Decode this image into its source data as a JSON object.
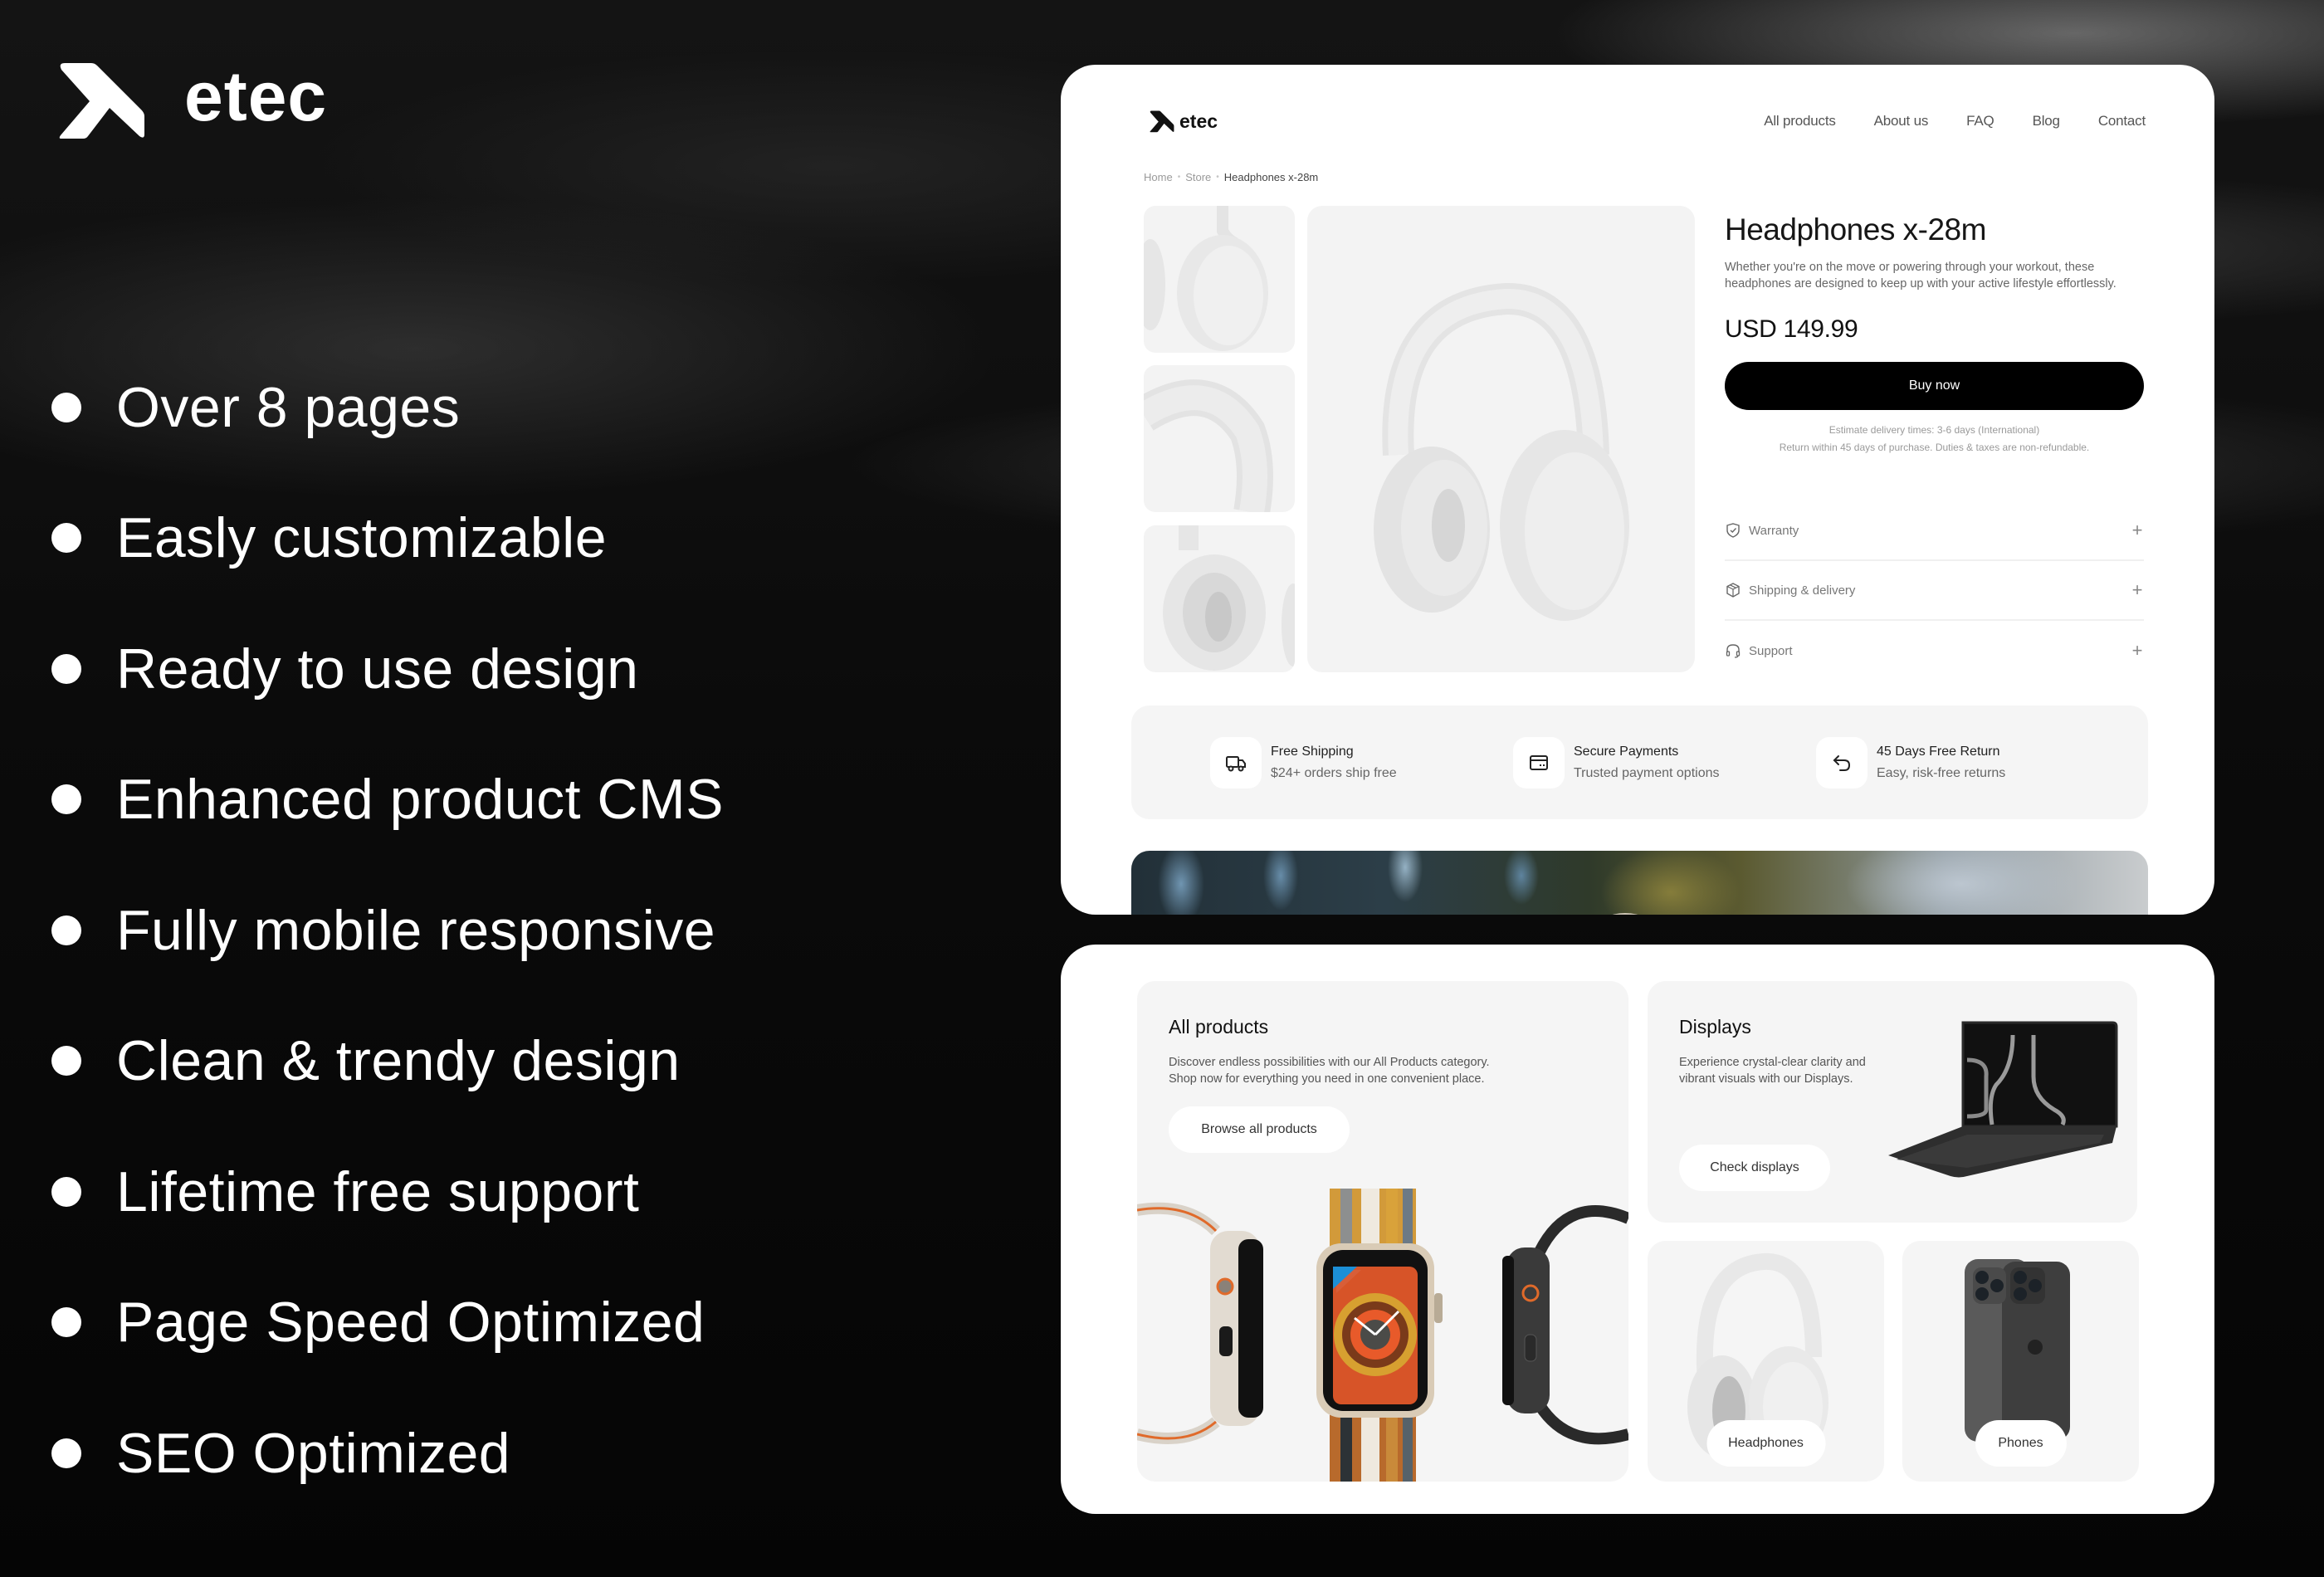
{
  "brand": {
    "name": "etec",
    "icon": "etec-arrow-logo-icon"
  },
  "features": [
    "Over 8 pages",
    "Easly customizable",
    "Ready to use design",
    "Enhanced product CMS",
    "Fully mobile responsive",
    "Clean & trendy design",
    "Lifetime free support",
    "Page Speed Optimized",
    "SEO Optimized"
  ],
  "product_page": {
    "logo_text": "etec",
    "nav": [
      "All products",
      "About us",
      "FAQ",
      "Blog",
      "Contact"
    ],
    "breadcrumb": [
      "Home",
      "Store",
      "Headphones x-28m"
    ],
    "product": {
      "title": "Headphones x-28m",
      "description": "Whether you're on the move or powering through your workout, these headphones are designed to keep up with your active lifestyle effortlessly.",
      "price": "USD 149.99",
      "buy_label": "Buy now",
      "delivery_note": "Estimate delivery times: 3-6 days (International)",
      "return_note": "Return within 45 days of purchase. Duties & taxes are non-refundable."
    },
    "accordion": [
      {
        "label": "Warranty",
        "icon": "shield-check-icon"
      },
      {
        "label": "Shipping & delivery",
        "icon": "package-icon"
      },
      {
        "label": "Support",
        "icon": "headset-icon"
      }
    ],
    "perks": [
      {
        "title": "Free Shipping",
        "subtitle": "$24+ orders ship free",
        "icon": "truck-icon"
      },
      {
        "title": "Secure Payments",
        "subtitle": "Trusted payment options",
        "icon": "credit-card-icon"
      },
      {
        "title": "45 Days Free Return",
        "subtitle": "Easy, risk-free returns",
        "icon": "return-arrow-icon"
      }
    ]
  },
  "categories_page": {
    "all_products": {
      "title": "All products",
      "description_line1": "Discover endless possibilities with our All Products category.",
      "description_line2": "Shop now for everything you need in one convenient place.",
      "button": "Browse all products"
    },
    "displays": {
      "title": "Displays",
      "description_line1": "Experience crystal-clear clarity and",
      "description_line2": "vibrant visuals with our Displays.",
      "button": "Check displays"
    },
    "headphones": {
      "button": "Headphones"
    },
    "phones": {
      "button": "Phones"
    }
  },
  "colors": {
    "background": "#0a0a0a",
    "card": "#ffffff",
    "panel": "#f5f5f5",
    "primary_button": "#000000",
    "text_primary": "#111111",
    "text_muted": "#777777"
  }
}
